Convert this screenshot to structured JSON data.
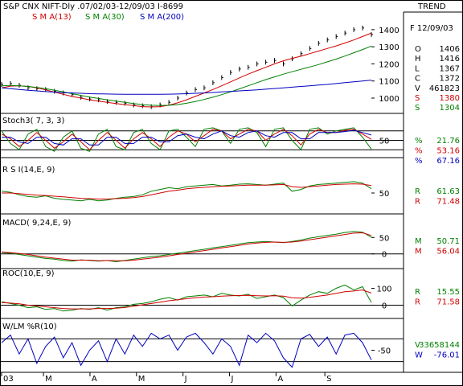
{
  "header": {
    "title": "S&P CNX NIFT-Dly .07/02/03-12/09/03  I-8699",
    "trend_label": "TREND",
    "legend": [
      {
        "label": "S M A(13)",
        "color": "#d00000"
      },
      {
        "label": "S M A(30)",
        "color": "#008000"
      },
      {
        "label": "S M A(200)",
        "color": "#0000c0"
      }
    ]
  },
  "colors": {
    "price": "#000000",
    "red": "#d00000",
    "green": "#008000",
    "blue": "#0000c0",
    "grid": "#000000",
    "border": "#000000"
  },
  "info_panel": {
    "date": "F 12/09/03",
    "rows": [
      {
        "key": "O",
        "value": "1406",
        "color": "#000000"
      },
      {
        "key": "H",
        "value": "1416",
        "color": "#000000"
      },
      {
        "key": "L",
        "value": "1367",
        "color": "#000000"
      },
      {
        "key": "C",
        "value": "1372",
        "color": "#000000"
      },
      {
        "key": "V",
        "value": "461823",
        "color": "#000000"
      },
      {
        "key": "S",
        "value": "1380",
        "color": "#d00000"
      },
      {
        "key": "S",
        "value": "1304",
        "color": "#008000"
      }
    ]
  },
  "panels": {
    "stoch": {
      "title": "Stoch3( 7, 3, 3)",
      "readouts": [
        {
          "key": "%",
          "value": "21.76",
          "color": "#008000"
        },
        {
          "key": "%",
          "value": "53.16",
          "color": "#d00000"
        },
        {
          "key": "%",
          "value": "67.16",
          "color": "#0000c0"
        }
      ]
    },
    "rsi": {
      "title": "R S I(14,E, 9)",
      "readouts": [
        {
          "key": "R",
          "value": "61.63",
          "color": "#008000"
        },
        {
          "key": "R",
          "value": "71.48",
          "color": "#d00000"
        }
      ]
    },
    "macd": {
      "title": "MACD( 9,24,E, 9)",
      "readouts": [
        {
          "key": "M",
          "value": "50.71",
          "color": "#008000"
        },
        {
          "key": "M",
          "value": "56.04",
          "color": "#d00000"
        }
      ]
    },
    "roc": {
      "title": "ROC(10,E, 9)",
      "readouts": [
        {
          "key": "R",
          "value": "15.55",
          "color": "#008000"
        },
        {
          "key": "R",
          "value": "71.58",
          "color": "#d00000"
        }
      ]
    },
    "wlm": {
      "title": "W/LM %R(10)",
      "readouts": [
        {
          "key": "V",
          "value": "33658144",
          "color": "#008000"
        },
        {
          "key": "W",
          "value": "-76.01",
          "color": "#0000c0"
        }
      ]
    }
  },
  "chart_data": [
    {
      "type": "line",
      "panel": "price",
      "ylim": [
        920,
        1470
      ],
      "yticks": [
        1000,
        1100,
        1200,
        1300,
        1400
      ],
      "x_months": [
        "03",
        "M",
        "A",
        "M",
        "J",
        "J",
        "A",
        "S"
      ],
      "month_start_index": [
        0,
        18,
        38,
        58,
        78,
        98,
        118,
        139
      ],
      "series": [
        {
          "name": "S M A(13)",
          "color": "#d00000",
          "values": [
            1060,
            1070,
            1072,
            1068,
            1060,
            1048,
            1035,
            1022,
            1010,
            1000,
            990,
            982,
            975,
            968,
            962,
            956,
            950,
            948,
            950,
            958,
            972,
            990,
            1010,
            1030,
            1050,
            1072,
            1095,
            1118,
            1140,
            1160,
            1180,
            1200,
            1218,
            1232,
            1245,
            1260,
            1275,
            1290,
            1305,
            1322,
            1340,
            1360,
            1380
          ]
        },
        {
          "name": "S M A(30)",
          "color": "#008000",
          "values": [
            1072,
            1074,
            1072,
            1068,
            1062,
            1055,
            1046,
            1036,
            1026,
            1016,
            1006,
            998,
            990,
            982,
            975,
            968,
            962,
            958,
            956,
            958,
            962,
            970,
            980,
            992,
            1005,
            1020,
            1036,
            1054,
            1072,
            1090,
            1108,
            1124,
            1140,
            1154,
            1168,
            1182,
            1196,
            1212,
            1228,
            1246,
            1265,
            1284,
            1304
          ]
        },
        {
          "name": "S M A(200)",
          "color": "#0000c0",
          "values": [
            1060,
            1055,
            1050,
            1046,
            1042,
            1038,
            1035,
            1032,
            1030,
            1028,
            1026,
            1025,
            1024,
            1023,
            1022,
            1022,
            1022,
            1022,
            1022,
            1023,
            1024,
            1026,
            1028,
            1030,
            1033,
            1036,
            1039,
            1042,
            1045,
            1048,
            1052,
            1056,
            1060,
            1064,
            1068,
            1072,
            1076,
            1080,
            1085,
            1090,
            1095,
            1100,
            1105
          ]
        }
      ],
      "price_close": [
        1080,
        1085,
        1075,
        1060,
        1055,
        1050,
        1040,
        1030,
        1020,
        1005,
        995,
        990,
        980,
        975,
        970,
        960,
        955,
        950,
        960,
        975,
        1000,
        1030,
        1050,
        1060,
        1090,
        1120,
        1150,
        1170,
        1180,
        1200,
        1210,
        1220,
        1200,
        1230,
        1260,
        1290,
        1320,
        1340,
        1360,
        1380,
        1400,
        1410,
        1372
      ]
    },
    {
      "type": "line",
      "panel": "stoch",
      "ylim": [
        0,
        100
      ],
      "levels": [
        20,
        50,
        80
      ],
      "yticks": [
        50
      ],
      "series": [
        {
          "name": "%",
          "color": "#008000",
          "values": [
            80,
            40,
            20,
            70,
            85,
            30,
            15,
            60,
            80,
            25,
            15,
            70,
            85,
            30,
            20,
            75,
            85,
            40,
            20,
            80,
            85,
            60,
            30,
            85,
            90,
            80,
            40,
            85,
            90,
            75,
            30,
            85,
            90,
            50,
            20,
            85,
            90,
            70,
            80,
            85,
            90,
            60,
            22
          ]
        },
        {
          "name": "%",
          "color": "#d00000",
          "values": [
            70,
            55,
            30,
            50,
            75,
            50,
            25,
            45,
            70,
            45,
            20,
            50,
            75,
            50,
            25,
            55,
            75,
            55,
            30,
            60,
            80,
            70,
            45,
            65,
            85,
            80,
            55,
            70,
            85,
            80,
            50,
            70,
            85,
            65,
            35,
            70,
            85,
            75,
            75,
            82,
            85,
            70,
            53
          ]
        },
        {
          "name": "%",
          "color": "#0000c0",
          "values": [
            60,
            60,
            45,
            40,
            60,
            60,
            40,
            35,
            55,
            55,
            35,
            35,
            60,
            60,
            40,
            40,
            60,
            60,
            45,
            45,
            65,
            70,
            60,
            55,
            70,
            80,
            65,
            60,
            75,
            80,
            65,
            60,
            75,
            75,
            55,
            55,
            75,
            75,
            75,
            78,
            82,
            75,
            67
          ]
        }
      ]
    },
    {
      "type": "line",
      "panel": "rsi",
      "ylim": [
        0,
        100
      ],
      "yticks": [
        50
      ],
      "series": [
        {
          "name": "R",
          "color": "#008000",
          "values": [
            55,
            52,
            45,
            40,
            38,
            42,
            35,
            32,
            30,
            28,
            32,
            28,
            30,
            35,
            38,
            40,
            45,
            55,
            60,
            65,
            62,
            68,
            70,
            72,
            74,
            70,
            72,
            75,
            76,
            74,
            72,
            75,
            78,
            55,
            60,
            70,
            74,
            76,
            78,
            80,
            82,
            78,
            62
          ]
        },
        {
          "name": "R",
          "color": "#d00000",
          "values": [
            50,
            50,
            48,
            46,
            44,
            43,
            41,
            39,
            37,
            35,
            34,
            33,
            33,
            34,
            35,
            37,
            40,
            45,
            50,
            55,
            58,
            62,
            64,
            66,
            68,
            69,
            70,
            71,
            72,
            72,
            72,
            73,
            74,
            68,
            66,
            68,
            70,
            72,
            74,
            75,
            76,
            75,
            71
          ]
        }
      ]
    },
    {
      "type": "line",
      "panel": "macd",
      "ylim": [
        -35,
        80
      ],
      "yticks": [
        50,
        0
      ],
      "zero_line": 0,
      "series": [
        {
          "name": "M",
          "color": "#008000",
          "values": [
            5,
            2,
            -2,
            -6,
            -10,
            -14,
            -16,
            -20,
            -22,
            -18,
            -20,
            -22,
            -20,
            -24,
            -20,
            -16,
            -12,
            -8,
            -6,
            -2,
            2,
            6,
            10,
            14,
            18,
            22,
            26,
            30,
            34,
            36,
            38,
            36,
            34,
            38,
            42,
            48,
            52,
            56,
            60,
            65,
            68,
            66,
            51
          ]
        },
        {
          "name": "M",
          "color": "#d00000",
          "values": [
            6,
            4,
            1,
            -2,
            -6,
            -10,
            -13,
            -16,
            -19,
            -19,
            -19,
            -21,
            -20,
            -21,
            -21,
            -19,
            -16,
            -13,
            -10,
            -6,
            -2,
            2,
            6,
            10,
            14,
            18,
            22,
            26,
            30,
            33,
            35,
            36,
            35,
            36,
            39,
            43,
            47,
            51,
            55,
            59,
            63,
            64,
            56
          ]
        }
      ]
    },
    {
      "type": "line",
      "panel": "roc",
      "ylim": [
        -60,
        160
      ],
      "yticks": [
        100,
        0
      ],
      "zero_line": 0,
      "series": [
        {
          "name": "R",
          "color": "#008000",
          "values": [
            20,
            10,
            0,
            -15,
            -10,
            -25,
            -20,
            -35,
            -30,
            -20,
            -25,
            -15,
            -30,
            -15,
            -10,
            5,
            10,
            20,
            35,
            45,
            30,
            50,
            55,
            60,
            50,
            70,
            60,
            55,
            65,
            40,
            50,
            60,
            45,
            -5,
            30,
            60,
            80,
            70,
            100,
            120,
            90,
            110,
            16
          ]
        },
        {
          "name": "R",
          "color": "#d00000",
          "values": [
            15,
            12,
            8,
            0,
            -5,
            -10,
            -15,
            -20,
            -22,
            -22,
            -22,
            -20,
            -20,
            -18,
            -14,
            -6,
            2,
            10,
            18,
            26,
            32,
            38,
            44,
            48,
            50,
            54,
            56,
            57,
            58,
            56,
            55,
            56,
            54,
            44,
            42,
            46,
            54,
            60,
            70,
            80,
            84,
            90,
            72
          ]
        }
      ]
    },
    {
      "type": "line",
      "panel": "wlm",
      "ylim": [
        -100,
        0
      ],
      "yticks": [
        -50
      ],
      "levels": [
        -20,
        -80
      ],
      "series": [
        {
          "name": "W",
          "color": "#0000c0",
          "values": [
            -30,
            -10,
            -60,
            -20,
            -85,
            -40,
            -15,
            -70,
            -30,
            -90,
            -50,
            -25,
            -80,
            -20,
            -60,
            -10,
            -40,
            -5,
            -20,
            -10,
            -50,
            -15,
            -5,
            -30,
            -60,
            -20,
            -40,
            -90,
            -10,
            -30,
            -5,
            -25,
            -70,
            -95,
            -20,
            -8,
            -40,
            -15,
            -60,
            -10,
            -5,
            -30,
            -76
          ]
        }
      ]
    }
  ]
}
